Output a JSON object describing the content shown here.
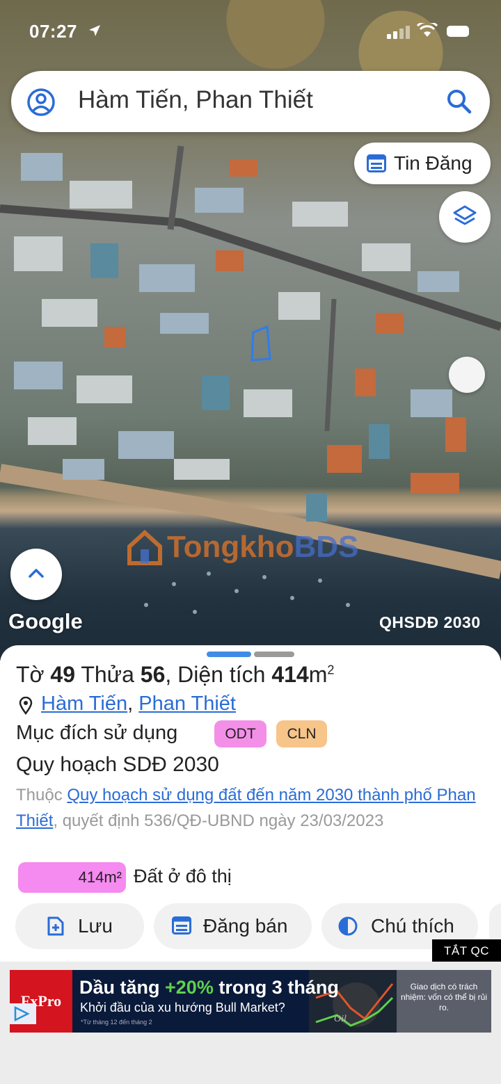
{
  "status_bar": {
    "time": "07:27"
  },
  "search": {
    "value": "Hàm Tiến, Phan Thiết"
  },
  "map": {
    "tin_dang_label": "Tin Đăng",
    "watermark_part1": "Tongkho",
    "watermark_part2": "BDS",
    "google_logo": "Google",
    "layer_label": "QHSDĐ 2030"
  },
  "parcel": {
    "to_label": "Tờ",
    "to_value": "49",
    "thua_label": "Thửa",
    "thua_value": "56",
    "area_label": "Diện tích",
    "area_value": "414",
    "area_unit": "m",
    "area_unit_sup": "2",
    "ward": "Hàm Tiến",
    "separator": ",",
    "city": "Phan Thiết",
    "purpose_label": "Mục đích sử dụng",
    "purpose_codes": [
      "ODT",
      "CLN"
    ],
    "plan_title": "Quy hoạch SDĐ 2030",
    "plan_prefix": "Thuộc",
    "plan_link": "Quy hoạch sử dụng đất đến năm 2030 thành phố Phan Thiết",
    "plan_suffix": ", quyết định 536/QĐ-UBND ngày 23/03/2023",
    "area_bar_value": "414m²",
    "area_bar_label": "Đất ở đô thị",
    "area_bar_fraction": 1.0
  },
  "actions": {
    "save": "Lưu",
    "post": "Đăng bán",
    "legend": "Chú thích"
  },
  "ad": {
    "close_label": "TẮT QC",
    "brand": "FxPro",
    "headline_a": "Dầu tăng ",
    "headline_hl": "+20%",
    "headline_b": " trong 3 tháng",
    "subline": "Khởi đầu của xu hướng Bull Market?",
    "footnote": "*Từ tháng 12 đến tháng 2",
    "chart_word": "Oil",
    "disclaimer": "Giao dịch có trách nhiệm: vốn có thể bị rủi ro."
  },
  "colors": {
    "accent": "#2a6cd6",
    "odt": "#f48fe8",
    "cln": "#f7c48a",
    "area_bar": "#f58af0"
  }
}
